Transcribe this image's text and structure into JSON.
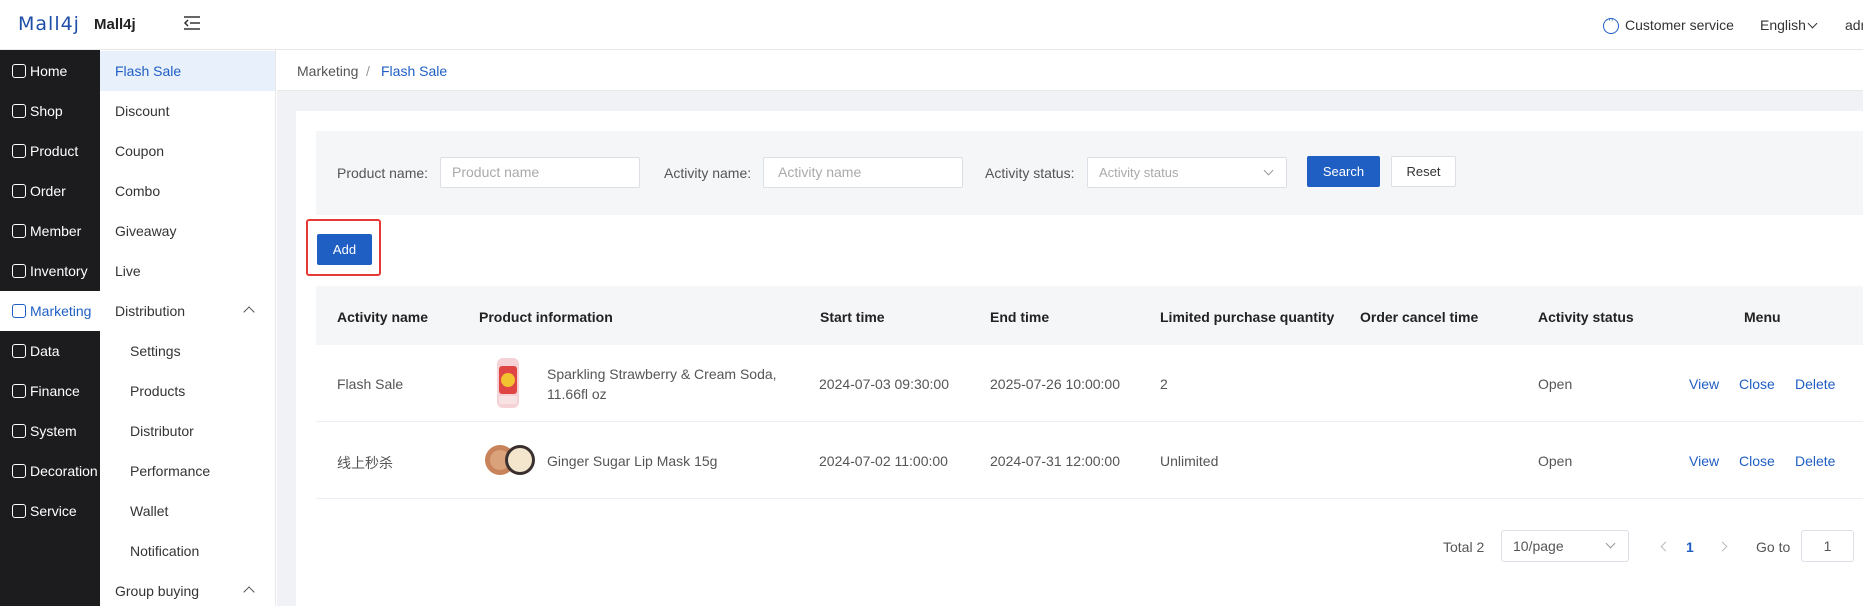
{
  "header": {
    "logo": "Mall4j",
    "brand": "Mall4j",
    "customer_service": "Customer service",
    "language": "English",
    "user": "admin"
  },
  "sidebar": {
    "items": [
      {
        "label": "Home",
        "icon": "home-icon"
      },
      {
        "label": "Shop",
        "icon": "shop-icon"
      },
      {
        "label": "Product",
        "icon": "product-icon"
      },
      {
        "label": "Order",
        "icon": "order-icon"
      },
      {
        "label": "Member",
        "icon": "member-icon"
      },
      {
        "label": "Inventory",
        "icon": "inventory-icon"
      },
      {
        "label": "Marketing",
        "icon": "marketing-icon"
      },
      {
        "label": "Data",
        "icon": "data-icon"
      },
      {
        "label": "Finance",
        "icon": "finance-icon"
      },
      {
        "label": "System",
        "icon": "system-icon"
      },
      {
        "label": "Decoration",
        "icon": "decoration-icon"
      },
      {
        "label": "Service",
        "icon": "service-icon"
      }
    ],
    "active": "Marketing"
  },
  "submenu": {
    "items": [
      {
        "label": "Flash Sale"
      },
      {
        "label": "Discount"
      },
      {
        "label": "Coupon"
      },
      {
        "label": "Combo"
      },
      {
        "label": "Giveaway"
      },
      {
        "label": "Live"
      },
      {
        "label": "Distribution"
      },
      {
        "label": "Settings"
      },
      {
        "label": "Products"
      },
      {
        "label": "Distributor"
      },
      {
        "label": "Performance"
      },
      {
        "label": "Wallet"
      },
      {
        "label": "Notification"
      },
      {
        "label": "Group buying"
      }
    ]
  },
  "breadcrumb": {
    "parent": "Marketing",
    "separator": "/",
    "current": "Flash Sale"
  },
  "filter": {
    "product_name_label": "Product name:",
    "product_name_placeholder": "Product name",
    "activity_name_label": "Activity name:",
    "activity_name_placeholder": "Activity name",
    "activity_status_label": "Activity status:",
    "activity_status_placeholder": "Activity status",
    "search": "Search",
    "reset": "Reset"
  },
  "add_button": "Add",
  "table": {
    "columns": [
      "Activity name",
      "Product information",
      "Start time",
      "End time",
      "Limited purchase quantity",
      "Order cancel time",
      "Activity status",
      "Menu"
    ],
    "rows": [
      {
        "activity_name": "Flash Sale",
        "product_line1": "Sparkling Strawberry & Cream Soda,",
        "product_line2": "11.66fl oz",
        "start": "2024-07-03 09:30:00",
        "end": "2025-07-26 10:00:00",
        "limit": "2",
        "cancel_time": "",
        "status": "Open",
        "actions": [
          "View",
          "Close",
          "Delete"
        ]
      },
      {
        "activity_name": "线上秒杀",
        "product_line1": "Ginger Sugar Lip Mask 15g",
        "product_line2": "",
        "start": "2024-07-02 11:00:00",
        "end": "2024-07-31 12:00:00",
        "limit": "Unlimited",
        "cancel_time": "",
        "status": "Open",
        "actions": [
          "View",
          "Close",
          "Delete"
        ]
      }
    ]
  },
  "pagination": {
    "total": "Total 2",
    "page_size": "10/page",
    "current_page": "1",
    "goto_label": "Go to",
    "goto_value": "1"
  },
  "colors": {
    "accent": "#1f5fc4",
    "sidebar_bg": "#1c1c1e",
    "highlight": "#e53935"
  }
}
